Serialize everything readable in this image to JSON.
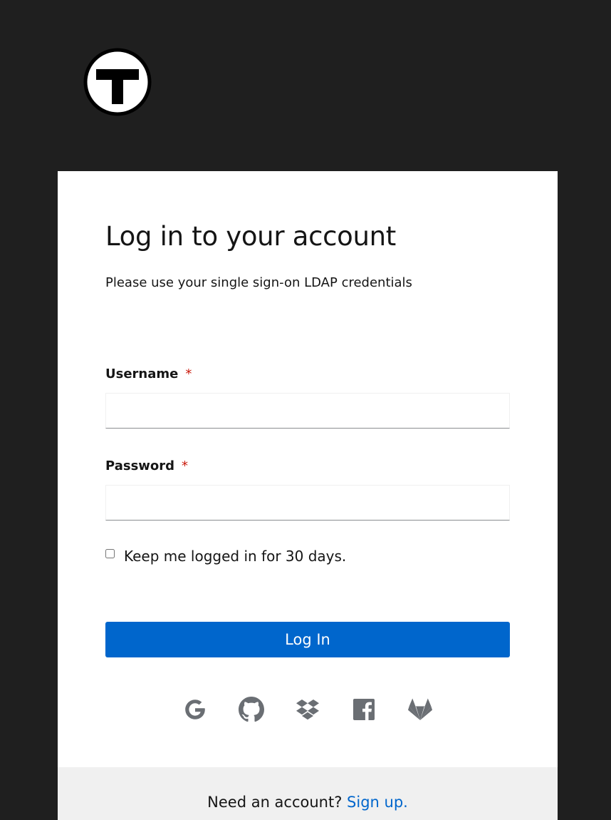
{
  "brand": {
    "logo_icon": "t-logo-icon"
  },
  "login": {
    "title": "Log in to your account",
    "subtitle": "Please use your single sign-on LDAP credentials",
    "username_label": "Username",
    "username_value": "",
    "username_placeholder": "",
    "password_label": "Password",
    "password_value": "",
    "password_placeholder": "",
    "required_marker": "*",
    "remember_label": "Keep me logged in for 30 days.",
    "remember_checked": false,
    "login_button": "Log In"
  },
  "social_logins": [
    {
      "name": "Google",
      "icon": "google-icon"
    },
    {
      "name": "GitHub",
      "icon": "github-icon"
    },
    {
      "name": "Dropbox",
      "icon": "dropbox-icon"
    },
    {
      "name": "Facebook",
      "icon": "facebook-icon"
    },
    {
      "name": "GitLab",
      "icon": "gitlab-icon"
    }
  ],
  "footer": {
    "prompt": "Need an account?",
    "signup_link": "Sign up."
  },
  "colors": {
    "page_background": "#1f1f1f",
    "card_background": "#ffffff",
    "primary": "#0066cc",
    "required": "#c9190b",
    "icon": "#6a6e73",
    "footer_background": "#f0f0f0"
  }
}
